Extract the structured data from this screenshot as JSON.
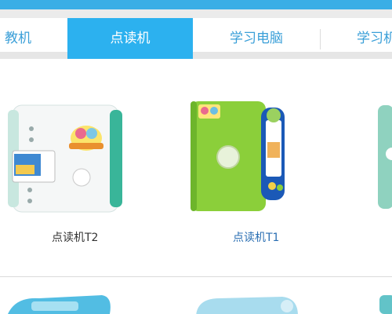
{
  "nav": {
    "tabs": [
      {
        "label": "教机",
        "active": false
      },
      {
        "label": "点读机",
        "active": true
      },
      {
        "label": "学习电脑",
        "active": false
      },
      {
        "label": "学习机",
        "active": false
      }
    ]
  },
  "products": [
    {
      "name": "点读机T2",
      "icon": "white-green-reading-pen-device"
    },
    {
      "name": "点读机T1",
      "icon": "green-blue-reading-pen-device"
    }
  ],
  "colors": {
    "accent": "#2cb1ef",
    "top_bar": "#3aaee6",
    "tab_text": "#3a9fd8"
  }
}
